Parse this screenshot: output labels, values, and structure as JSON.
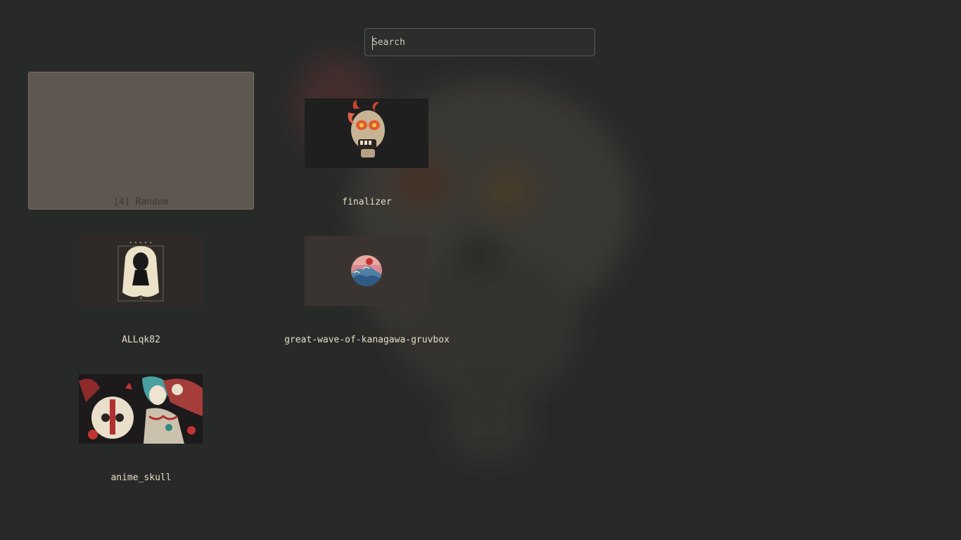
{
  "search": {
    "placeholder": "Search",
    "value": ""
  },
  "items": [
    {
      "label": "[4] Random",
      "selected": true,
      "thumbnail": "none"
    },
    {
      "label": "finalizer",
      "selected": false,
      "thumbnail": "flaming-skull"
    },
    {
      "label": "ALLqk82",
      "selected": false,
      "thumbnail": "white-haired-figure"
    },
    {
      "label": "great-wave-of-kanagawa-gruvbox",
      "selected": false,
      "thumbnail": "wave-circle"
    },
    {
      "label": "anime_skull",
      "selected": false,
      "thumbnail": "anime-skull-art"
    }
  ],
  "colors": {
    "background": "#282a29",
    "selected_tile": "#5e574f",
    "label_text": "#e8dcc5"
  }
}
